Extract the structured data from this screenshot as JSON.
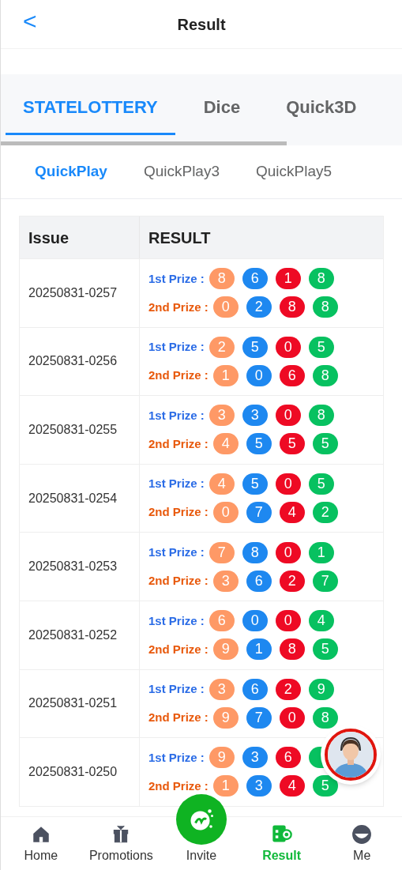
{
  "header": {
    "back": "<",
    "title": "Result"
  },
  "game_tabs": [
    {
      "label": "STATELOTTERY",
      "selected": true
    },
    {
      "label": "Dice",
      "selected": false
    },
    {
      "label": "Quick3D",
      "selected": false
    }
  ],
  "play_tabs": [
    {
      "label": "QuickPlay",
      "selected": true
    },
    {
      "label": "QuickPlay3",
      "selected": false
    },
    {
      "label": "QuickPlay5",
      "selected": false
    }
  ],
  "table": {
    "columns": [
      "Issue",
      "RESULT"
    ],
    "rows": [
      {
        "issue": "20250831-0257",
        "prizes": [
          {
            "kind": "first",
            "label": "1st Prize :",
            "balls": [
              {
                "value": "8",
                "color": "#fe9966"
              },
              {
                "value": "6",
                "color": "#1e88f0"
              },
              {
                "value": "1",
                "color": "#ee0a24"
              },
              {
                "value": "8",
                "color": "#07c160"
              }
            ]
          },
          {
            "kind": "second",
            "label": "2nd Prize :",
            "balls": [
              {
                "value": "0",
                "color": "#fe9966"
              },
              {
                "value": "2",
                "color": "#1e88f0"
              },
              {
                "value": "8",
                "color": "#ee0a24"
              },
              {
                "value": "8",
                "color": "#07c160"
              }
            ]
          }
        ]
      },
      {
        "issue": "20250831-0256",
        "prizes": [
          {
            "kind": "first",
            "label": "1st Prize :",
            "balls": [
              {
                "value": "2",
                "color": "#fe9966"
              },
              {
                "value": "5",
                "color": "#1e88f0"
              },
              {
                "value": "0",
                "color": "#ee0a24"
              },
              {
                "value": "5",
                "color": "#07c160"
              }
            ]
          },
          {
            "kind": "second",
            "label": "2nd Prize :",
            "balls": [
              {
                "value": "1",
                "color": "#fe9966"
              },
              {
                "value": "0",
                "color": "#1e88f0"
              },
              {
                "value": "6",
                "color": "#ee0a24"
              },
              {
                "value": "8",
                "color": "#07c160"
              }
            ]
          }
        ]
      },
      {
        "issue": "20250831-0255",
        "prizes": [
          {
            "kind": "first",
            "label": "1st Prize :",
            "balls": [
              {
                "value": "3",
                "color": "#fe9966"
              },
              {
                "value": "3",
                "color": "#1e88f0"
              },
              {
                "value": "0",
                "color": "#ee0a24"
              },
              {
                "value": "8",
                "color": "#07c160"
              }
            ]
          },
          {
            "kind": "second",
            "label": "2nd Prize :",
            "balls": [
              {
                "value": "4",
                "color": "#fe9966"
              },
              {
                "value": "5",
                "color": "#1e88f0"
              },
              {
                "value": "5",
                "color": "#ee0a24"
              },
              {
                "value": "5",
                "color": "#07c160"
              }
            ]
          }
        ]
      },
      {
        "issue": "20250831-0254",
        "prizes": [
          {
            "kind": "first",
            "label": "1st Prize :",
            "balls": [
              {
                "value": "4",
                "color": "#fe9966"
              },
              {
                "value": "5",
                "color": "#1e88f0"
              },
              {
                "value": "0",
                "color": "#ee0a24"
              },
              {
                "value": "5",
                "color": "#07c160"
              }
            ]
          },
          {
            "kind": "second",
            "label": "2nd Prize :",
            "balls": [
              {
                "value": "0",
                "color": "#fe9966"
              },
              {
                "value": "7",
                "color": "#1e88f0"
              },
              {
                "value": "4",
                "color": "#ee0a24"
              },
              {
                "value": "2",
                "color": "#07c160"
              }
            ]
          }
        ]
      },
      {
        "issue": "20250831-0253",
        "prizes": [
          {
            "kind": "first",
            "label": "1st Prize :",
            "balls": [
              {
                "value": "7",
                "color": "#fe9966"
              },
              {
                "value": "8",
                "color": "#1e88f0"
              },
              {
                "value": "0",
                "color": "#ee0a24"
              },
              {
                "value": "1",
                "color": "#07c160"
              }
            ]
          },
          {
            "kind": "second",
            "label": "2nd Prize :",
            "balls": [
              {
                "value": "3",
                "color": "#fe9966"
              },
              {
                "value": "6",
                "color": "#1e88f0"
              },
              {
                "value": "2",
                "color": "#ee0a24"
              },
              {
                "value": "7",
                "color": "#07c160"
              }
            ]
          }
        ]
      },
      {
        "issue": "20250831-0252",
        "prizes": [
          {
            "kind": "first",
            "label": "1st Prize :",
            "balls": [
              {
                "value": "6",
                "color": "#fe9966"
              },
              {
                "value": "0",
                "color": "#1e88f0"
              },
              {
                "value": "0",
                "color": "#ee0a24"
              },
              {
                "value": "4",
                "color": "#07c160"
              }
            ]
          },
          {
            "kind": "second",
            "label": "2nd Prize :",
            "balls": [
              {
                "value": "9",
                "color": "#fe9966"
              },
              {
                "value": "1",
                "color": "#1e88f0"
              },
              {
                "value": "8",
                "color": "#ee0a24"
              },
              {
                "value": "5",
                "color": "#07c160"
              }
            ]
          }
        ]
      },
      {
        "issue": "20250831-0251",
        "prizes": [
          {
            "kind": "first",
            "label": "1st Prize :",
            "balls": [
              {
                "value": "3",
                "color": "#fe9966"
              },
              {
                "value": "6",
                "color": "#1e88f0"
              },
              {
                "value": "2",
                "color": "#ee0a24"
              },
              {
                "value": "9",
                "color": "#07c160"
              }
            ]
          },
          {
            "kind": "second",
            "label": "2nd Prize :",
            "balls": [
              {
                "value": "9",
                "color": "#fe9966"
              },
              {
                "value": "7",
                "color": "#1e88f0"
              },
              {
                "value": "0",
                "color": "#ee0a24"
              },
              {
                "value": "8",
                "color": "#07c160"
              }
            ]
          }
        ]
      },
      {
        "issue": "20250831-0250",
        "prizes": [
          {
            "kind": "first",
            "label": "1st Prize :",
            "balls": [
              {
                "value": "9",
                "color": "#fe9966"
              },
              {
                "value": "3",
                "color": "#1e88f0"
              },
              {
                "value": "6",
                "color": "#ee0a24"
              },
              {
                "color": "#07c160"
              }
            ]
          },
          {
            "kind": "second",
            "label": "2nd Prize :",
            "balls": [
              {
                "value": "1",
                "color": "#fe9966"
              },
              {
                "value": "3",
                "color": "#1e88f0"
              },
              {
                "value": "4",
                "color": "#ee0a24"
              },
              {
                "value": "5",
                "color": "#07c160"
              }
            ]
          }
        ]
      }
    ]
  },
  "nav": [
    {
      "kind": "home",
      "label": "Home",
      "selected": false
    },
    {
      "kind": "gift",
      "label": "Promotions",
      "selected": false
    },
    {
      "kind": "invite",
      "label": "Invite",
      "selected": false
    },
    {
      "kind": "result",
      "label": "Result",
      "selected": true
    },
    {
      "kind": "me",
      "label": "Me",
      "selected": false
    }
  ]
}
